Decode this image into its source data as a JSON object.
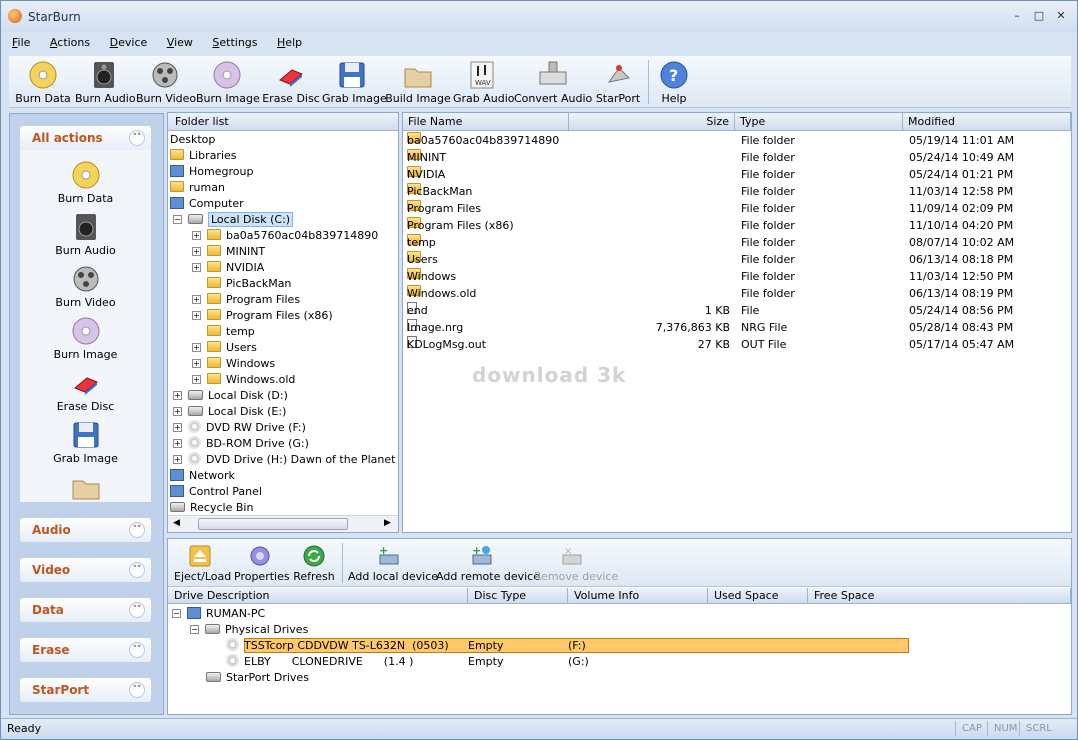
{
  "app": {
    "title": "StarBurn"
  },
  "menu": [
    "File",
    "Actions",
    "Device",
    "View",
    "Settings",
    "Help"
  ],
  "toolbar": {
    "items": [
      {
        "label": "Burn Data",
        "icon": "burn-data-icon"
      },
      {
        "label": "Burn Audio",
        "icon": "burn-audio-icon"
      },
      {
        "label": "Burn Video",
        "icon": "burn-video-icon"
      },
      {
        "label": "Burn Image",
        "icon": "burn-image-icon"
      },
      {
        "label": "Erase Disc",
        "icon": "erase-disc-icon"
      },
      {
        "label": "Grab Image",
        "icon": "grab-image-icon"
      },
      {
        "label": "Build Image",
        "icon": "build-image-icon"
      },
      {
        "label": "Grab Audio",
        "icon": "grab-audio-icon"
      },
      {
        "label": "Convert Audio",
        "icon": "convert-audio-icon"
      },
      {
        "label": "StarPort",
        "icon": "starport-icon"
      },
      {
        "label": "Help",
        "icon": "help-icon"
      }
    ]
  },
  "actions_panel": {
    "header": "All actions",
    "items": [
      "Burn Data",
      "Burn Audio",
      "Burn Video",
      "Burn Image",
      "Erase Disc",
      "Grab Image"
    ],
    "sections": [
      "Audio",
      "Video",
      "Data",
      "Erase",
      "StarPort"
    ]
  },
  "folder_tree": {
    "header": "Folder list",
    "nodes": [
      {
        "label": "Desktop"
      },
      {
        "label": "Libraries"
      },
      {
        "label": "Homegroup"
      },
      {
        "label": "ruman"
      },
      {
        "label": "Computer"
      },
      {
        "label": "Local Disk (C:)"
      },
      {
        "label": "ba0a5760ac04b839714890"
      },
      {
        "label": "MININT"
      },
      {
        "label": "NVIDIA"
      },
      {
        "label": "PicBackMan"
      },
      {
        "label": "Program Files"
      },
      {
        "label": "Program Files (x86)"
      },
      {
        "label": "temp"
      },
      {
        "label": "Users"
      },
      {
        "label": "Windows"
      },
      {
        "label": "Windows.old"
      },
      {
        "label": "Local Disk (D:)"
      },
      {
        "label": "Local Disk (E:)"
      },
      {
        "label": "DVD RW Drive (F:)"
      },
      {
        "label": "BD-ROM Drive (G:)"
      },
      {
        "label": "DVD Drive (H:) Dawn of the Planet of th"
      },
      {
        "label": "Network"
      },
      {
        "label": "Control Panel"
      },
      {
        "label": "Recycle Bin"
      }
    ]
  },
  "file_list": {
    "columns": [
      "File Name",
      "Size",
      "Type",
      "Modified"
    ],
    "rows": [
      {
        "name": "ba0a5760ac04b839714890",
        "size": "",
        "type": "File folder",
        "modified": "05/19/14 11:01 AM"
      },
      {
        "name": "MININT",
        "size": "",
        "type": "File folder",
        "modified": "05/24/14 10:49 AM"
      },
      {
        "name": "NVIDIA",
        "size": "",
        "type": "File folder",
        "modified": "05/24/14 01:21 PM"
      },
      {
        "name": "PicBackMan",
        "size": "",
        "type": "File folder",
        "modified": "11/03/14 12:58 PM"
      },
      {
        "name": "Program Files",
        "size": "",
        "type": "File folder",
        "modified": "11/09/14 02:09 PM"
      },
      {
        "name": "Program Files (x86)",
        "size": "",
        "type": "File folder",
        "modified": "11/10/14 04:20 PM"
      },
      {
        "name": "temp",
        "size": "",
        "type": "File folder",
        "modified": "08/07/14 10:02 AM"
      },
      {
        "name": "Users",
        "size": "",
        "type": "File folder",
        "modified": "06/13/14 08:18 PM"
      },
      {
        "name": "Windows",
        "size": "",
        "type": "File folder",
        "modified": "11/03/14 12:50 PM"
      },
      {
        "name": "Windows.old",
        "size": "",
        "type": "File folder",
        "modified": "06/13/14 08:19 PM"
      },
      {
        "name": "end",
        "size": "1 KB",
        "type": "File",
        "modified": "05/24/14 08:56 PM"
      },
      {
        "name": "Image.nrg",
        "size": "7,376,863 KB",
        "type": "NRG File",
        "modified": "05/28/14 08:43 PM"
      },
      {
        "name": "KDLogMsg.out",
        "size": "27 KB",
        "type": "OUT File",
        "modified": "05/17/14 05:47 AM"
      }
    ],
    "watermark": "download 3k"
  },
  "device_toolbar": {
    "items": [
      {
        "label": "Eject/Load",
        "icon": "eject-icon",
        "enabled": true
      },
      {
        "label": "Properties",
        "icon": "properties-icon",
        "enabled": true
      },
      {
        "label": "Refresh",
        "icon": "refresh-icon",
        "enabled": true
      },
      {
        "label": "Add local device",
        "icon": "add-local-device-icon",
        "enabled": true
      },
      {
        "label": "Add remote device",
        "icon": "add-remote-device-icon",
        "enabled": true
      },
      {
        "label": "Remove device",
        "icon": "remove-device-icon",
        "enabled": false
      }
    ]
  },
  "drives": {
    "columns": [
      "Drive Description",
      "Disc Type",
      "Volume Info",
      "Used Space",
      "Free Space"
    ],
    "root": "RUMAN-PC",
    "group_physical": "Physical Drives",
    "group_starport": "StarPort Drives",
    "rows": [
      {
        "name": "TSSTcorp CDDVDW TS-L632N  (0503)",
        "disc": "Empty",
        "volume": "(F:)"
      },
      {
        "name": "ELBY      CLONEDRIVE      (1.4 )",
        "disc": "Empty",
        "volume": "(G:)"
      }
    ]
  },
  "status": {
    "text": "Ready",
    "keys": [
      "CAP",
      "NUM",
      "SCRL"
    ]
  },
  "colors": {
    "accent": "#c0551c",
    "selection": "#ffc86b",
    "panel": "#bfd2ea"
  }
}
